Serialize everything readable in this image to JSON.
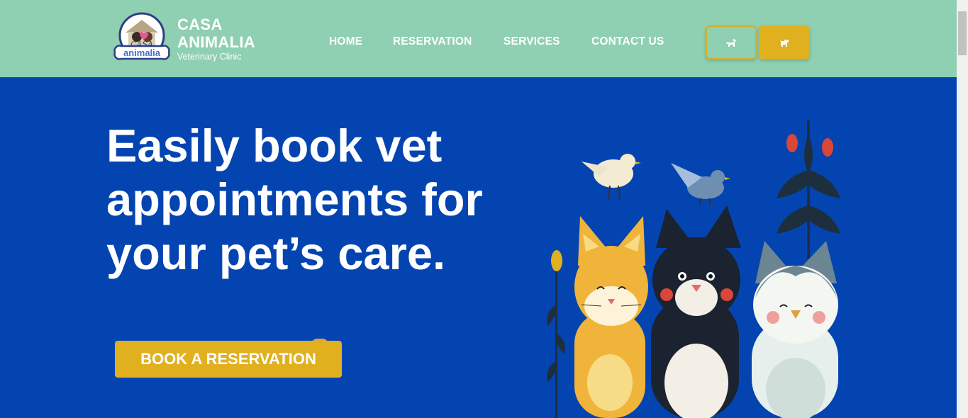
{
  "brand": {
    "name_line1": "CASA",
    "name_line2": "ANIMALIA",
    "tagline": "Veterinary Clinic",
    "logo_text_top": "CASA",
    "logo_text_bottom": "animalia"
  },
  "nav": {
    "items": [
      {
        "label": "HOME"
      },
      {
        "label": "RESERVATION"
      },
      {
        "label": "SERVICES"
      },
      {
        "label": "CONTACT US"
      }
    ],
    "pet_buttons": [
      {
        "icon": "dog-icon"
      },
      {
        "icon": "cat-icon"
      }
    ]
  },
  "hero": {
    "headline": "Easily book vet appointments for your pet’s care.",
    "cta_label": "BOOK A RESERVATION",
    "illustration": "cats-and-birds-illustration"
  },
  "colors": {
    "header_bg": "#8fcfb2",
    "hero_bg": "#0444b1",
    "accent": "#e0b01e",
    "text_light": "#ffffff"
  }
}
